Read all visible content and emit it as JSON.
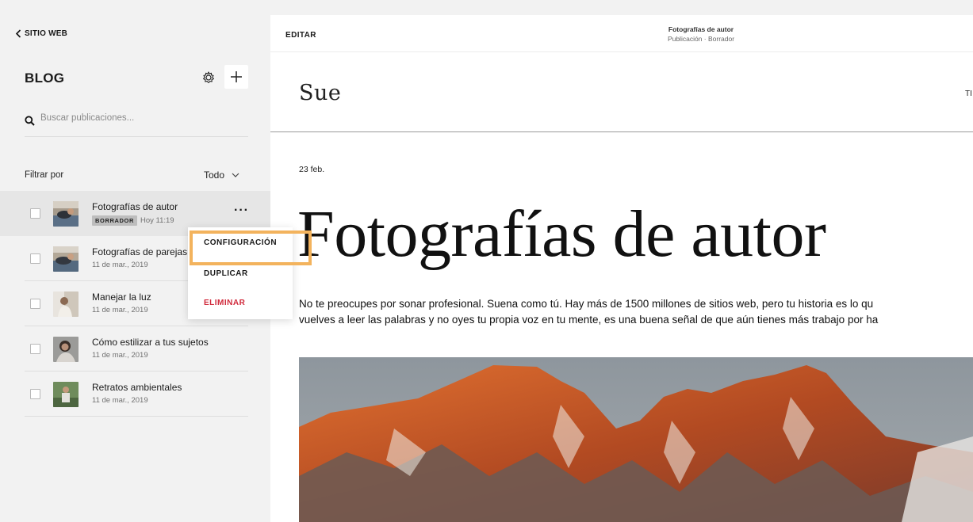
{
  "sidebar": {
    "back_label": "SITIO WEB",
    "title": "BLOG",
    "search_placeholder": "Buscar publicaciones...",
    "filter_label": "Filtrar por",
    "filter_value": "Todo",
    "posts": [
      {
        "title": "Fotografías de autor",
        "badge": "BORRADOR",
        "date": "Hoy 11:19"
      },
      {
        "title": "Fotografías de parejas",
        "date": "11 de mar., 2019"
      },
      {
        "title": "Manejar la luz",
        "date": "11 de mar., 2019"
      },
      {
        "title": "Cómo estilizar a tus sujetos",
        "date": "11 de mar., 2019"
      },
      {
        "title": "Retratos ambientales",
        "date": "11 de mar., 2019"
      }
    ],
    "more_label": "···"
  },
  "context_menu": {
    "settings": "CONFIGURACIÓN",
    "duplicate": "DUPLICAR",
    "delete": "ELIMINAR"
  },
  "topbar": {
    "edit_label": "EDITAR",
    "doc_title": "Fotografías de autor",
    "doc_subtitle": "Publicación · Borrador"
  },
  "site": {
    "logo": "Sue",
    "nav_partial": "TI"
  },
  "post": {
    "date": "23 feb.",
    "heading": "Fotografías de autor",
    "body_line1": "No te preocupes por sonar profesional. Suena como tú. Hay más de 1500 millones de sitios web, pero tu historia es lo qu",
    "body_line2": "vuelves a leer las palabras y no oyes tu propia voz en tu mente, es una buena señal de que aún tienes más trabajo por ha"
  },
  "colors": {
    "accent_highlight": "#f3b35d",
    "delete_red": "#d0283a",
    "sidebar_bg": "#f2f2f2"
  }
}
